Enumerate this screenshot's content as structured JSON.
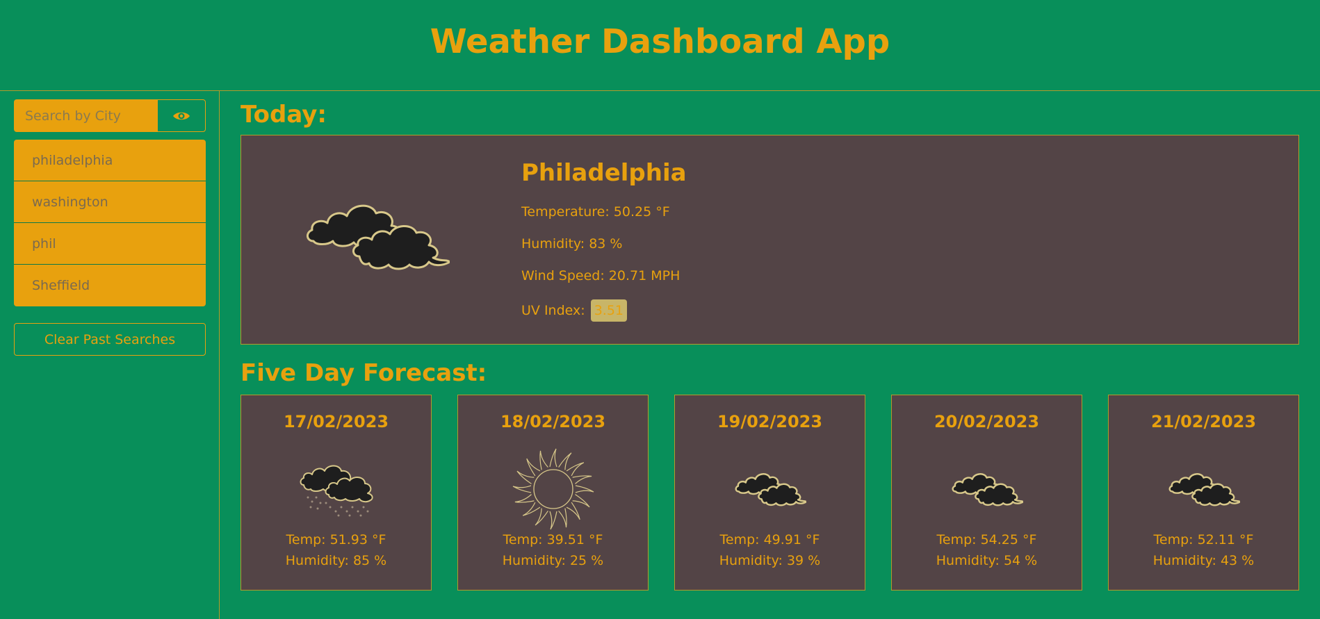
{
  "header": {
    "title": "Weather Dashboard App"
  },
  "search": {
    "placeholder": "Search by City",
    "button_icon": "eye-icon"
  },
  "history": {
    "items": [
      {
        "label": "philadelphia"
      },
      {
        "label": "washington"
      },
      {
        "label": "phil"
      },
      {
        "label": "Sheffield"
      }
    ],
    "clear_label": "Clear Past Searches"
  },
  "today": {
    "heading": "Today:",
    "city": "Philadelphia",
    "icon": "cloudy-icon",
    "temperature": "Temperature: 50.25 °F",
    "humidity": "Humidity: 83 %",
    "wind": "Wind Speed: 20.71 MPH",
    "uv_label": "UV Index:",
    "uv_value": "3.51"
  },
  "forecast": {
    "heading": "Five Day Forecast:",
    "days": [
      {
        "date": "17/02/2023",
        "icon": "rain-cloud-icon",
        "temp": "Temp: 51.93 °F",
        "humidity": "Humidity: 85 %"
      },
      {
        "date": "18/02/2023",
        "icon": "sun-icon",
        "temp": "Temp: 39.51 °F",
        "humidity": "Humidity: 25 %"
      },
      {
        "date": "19/02/2023",
        "icon": "cloudy-icon",
        "temp": "Temp: 49.91 °F",
        "humidity": "Humidity: 39 %"
      },
      {
        "date": "20/02/2023",
        "icon": "cloudy-icon",
        "temp": "Temp: 54.25 °F",
        "humidity": "Humidity: 54 %"
      },
      {
        "date": "21/02/2023",
        "icon": "cloudy-icon",
        "temp": "Temp: 52.11 °F",
        "humidity": "Humidity: 43 %"
      }
    ]
  },
  "colors": {
    "background": "#088f5a",
    "accent": "#e8a10e",
    "card": "#534446",
    "border": "#b49a2a",
    "uv_badge": "#c8b568"
  }
}
